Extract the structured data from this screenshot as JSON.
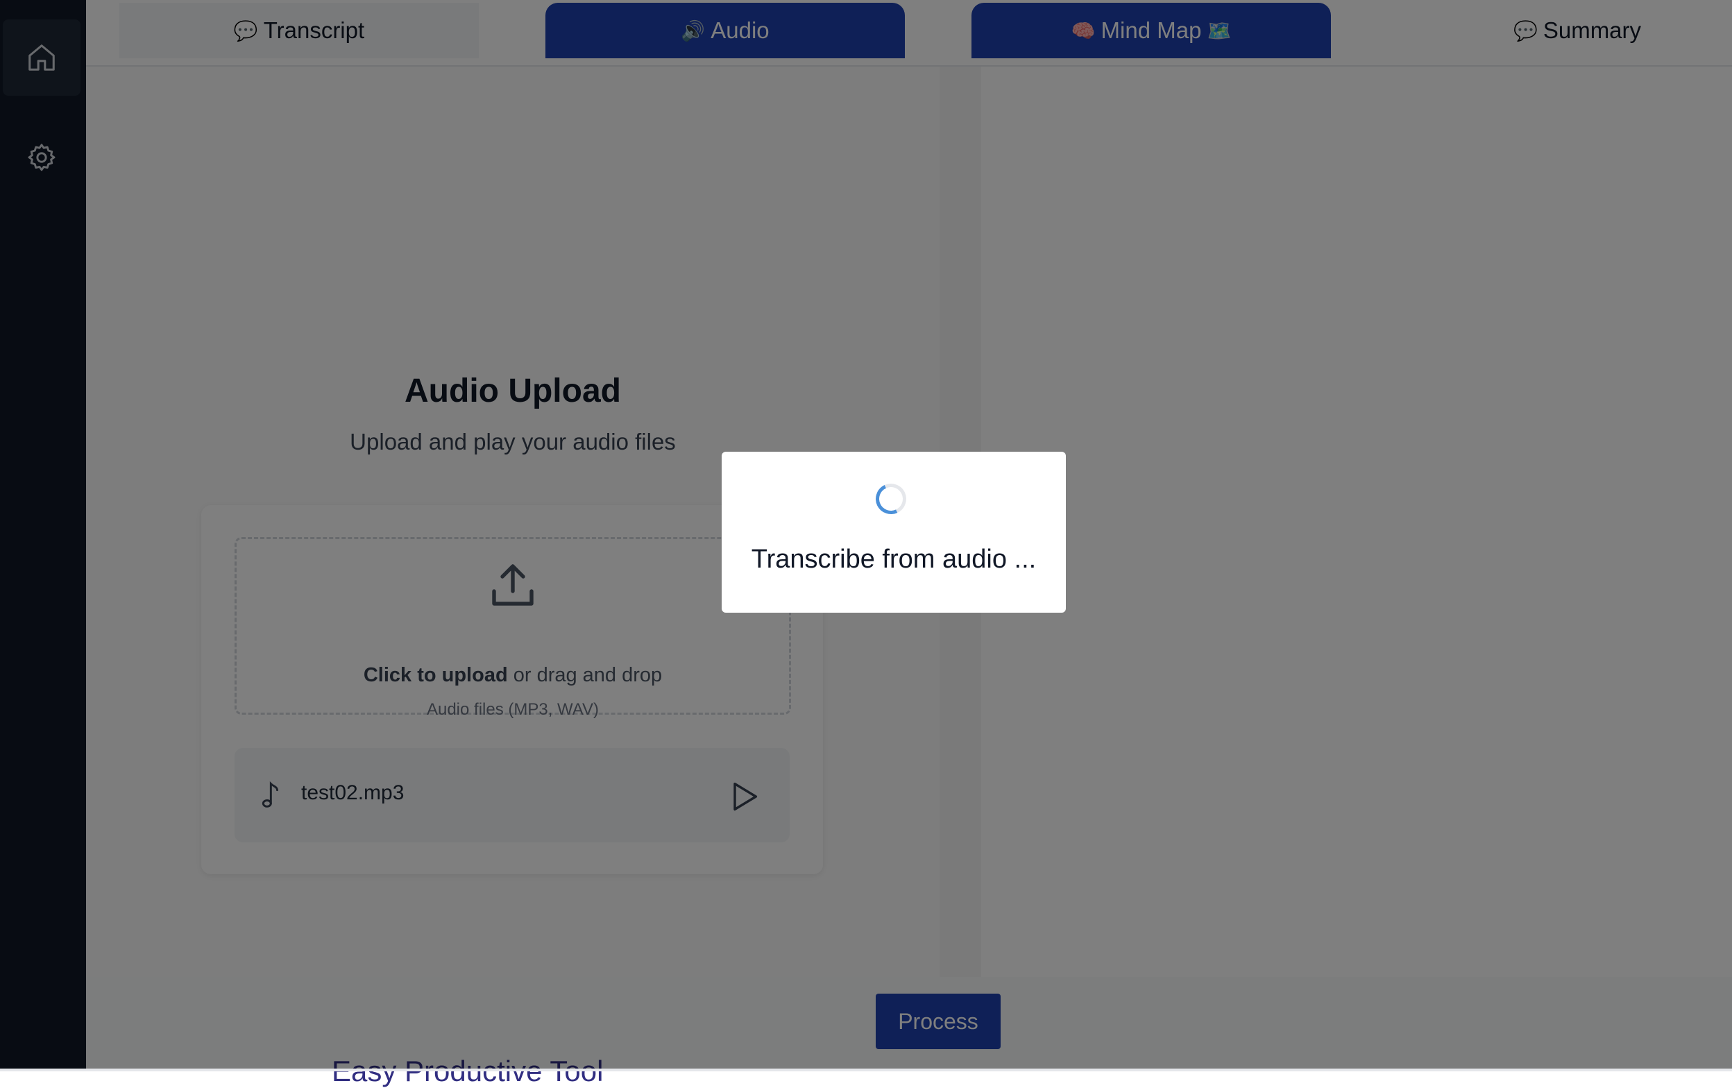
{
  "sidebar": {
    "items": [
      {
        "icon": "home-icon"
      },
      {
        "icon": "gear-icon"
      }
    ]
  },
  "tabs": [
    {
      "emoji": "💬",
      "label": "Transcript"
    },
    {
      "emoji": "🔊",
      "label": "Audio"
    },
    {
      "emoji": "🧠",
      "label": "Mind Map",
      "suffix_emoji": "🗺️"
    },
    {
      "emoji": "💬",
      "label": "Summary"
    }
  ],
  "upload": {
    "title": "Audio Upload",
    "subtitle": "Upload and play your audio files",
    "click_text": "Click to upload",
    "drag_text": " or drag and drop",
    "formats": "Audio files (MP3, WAV)"
  },
  "file": {
    "name": "test02.mp3"
  },
  "process_label": "Process",
  "footer_peek": "Easy Productive Tool",
  "modal": {
    "message": "Transcribe from audio ..."
  },
  "colors": {
    "accent": "#1e40af",
    "sidebar": "#111827",
    "spinner": "#4a90d9"
  }
}
